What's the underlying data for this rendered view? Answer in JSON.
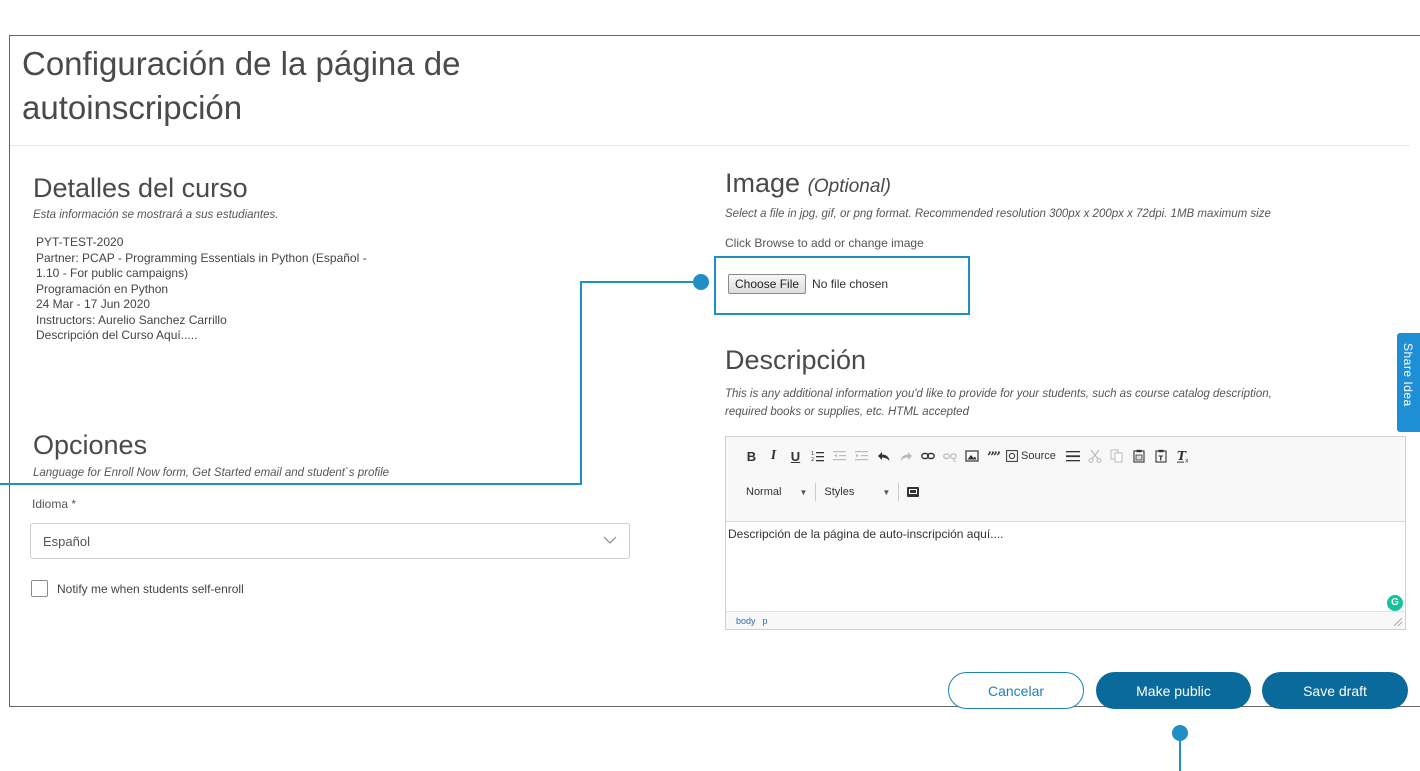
{
  "page": {
    "title_line1": "Configuración de la página de",
    "title_line2": "autoinscripción"
  },
  "course_details": {
    "heading": "Detalles del curso",
    "subtitle": "Esta información se mostrará a sus estudiantes.",
    "lines": [
      "PYT-TEST-2020",
      "Partner: PCAP - Programming Essentials in Python (Español -",
      "1.10 - For public campaigns)",
      "Programación en Python",
      "24 Mar - 17 Jun 2020",
      "Instructors: Aurelio Sanchez Carrillo",
      "Descripción del Curso Aquí....."
    ]
  },
  "options": {
    "heading": "Opciones",
    "subtitle": "Language for Enroll Now form, Get Started email and student`s profile",
    "language_label": "Idioma *",
    "language_value": "Español",
    "notify_label": "Notify me when students self-enroll",
    "notify_checked": false
  },
  "image": {
    "heading": "Image",
    "heading_optional": "(Optional)",
    "subtitle": "Select a file in jpg, gif, or png format. Recommended resolution 300px x 200px x 72dpi. 1MB maximum size",
    "browse_hint": "Click Browse to add or change image",
    "choose_file_label": "Choose File",
    "no_file_text": "No file chosen"
  },
  "description": {
    "heading": "Descripción",
    "subtitle_line1": "This is any additional information you'd like to provide for your students, such as course catalog description,",
    "subtitle_line2": "required books or supplies, etc. HTML accepted",
    "toolbar": {
      "bold": "B",
      "italic": "I",
      "underline": "U",
      "source_label": "Source",
      "format_value": "Normal",
      "styles_value": "Styles"
    },
    "content": "Descripción de la página de auto-inscripción aquí....",
    "path": [
      "body",
      "p"
    ],
    "grammarly_badge": "G"
  },
  "actions": {
    "cancel_label": "Cancelar",
    "make_public_label": "Make public",
    "save_draft_label": "Save draft"
  },
  "share_tab": {
    "label": "Share Idea"
  },
  "colors": {
    "primary": "#0b6a9c",
    "accent": "#1e82b7",
    "callout": "#1f8fc4",
    "share_tab": "#1e8fd4"
  }
}
